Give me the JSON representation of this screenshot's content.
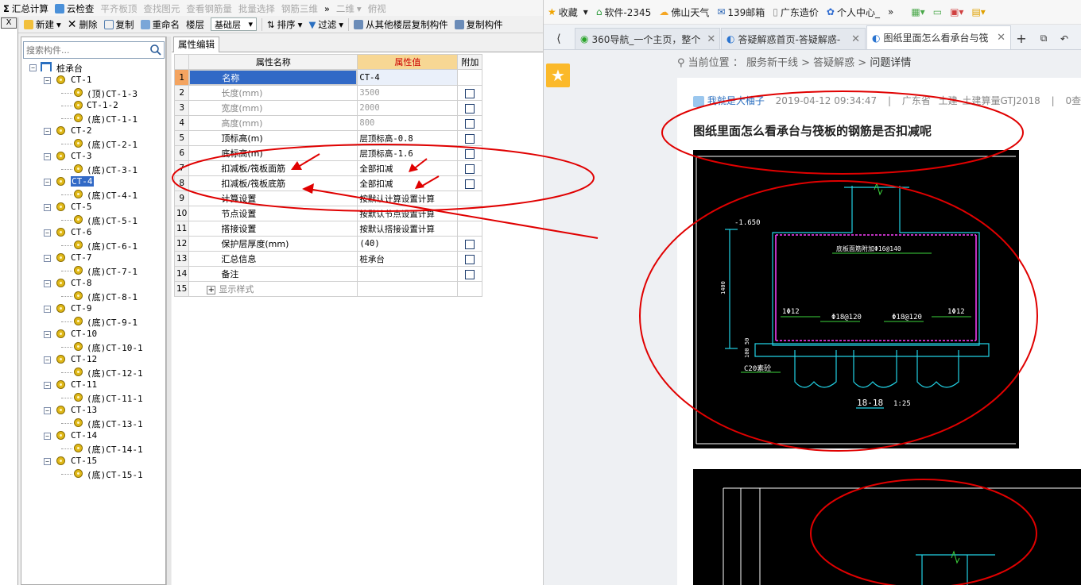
{
  "toolbar_top": {
    "items": [
      "汇总计算",
      "云检查",
      "平齐板顶",
      "查找图元",
      "查看钢筋量",
      "批量选择",
      "钢筋三维",
      "二维",
      "俯视"
    ]
  },
  "toolbar_main": {
    "new": "新建",
    "delete": "删除",
    "copy": "复制",
    "rename": "重命名",
    "floor_label": "楼层",
    "floor_value": "基础层",
    "sort": "排序",
    "filter": "过滤",
    "copy_from_floor": "从其他楼层复制构件",
    "copy_component": "复制构件"
  },
  "close_btn": "X",
  "search": {
    "placeholder": "搜索构件..."
  },
  "tree": {
    "root": "桩承台",
    "nodes": [
      {
        "label": "CT-1",
        "children": [
          "(顶)CT-1-3",
          "CT-1-2",
          "(底)CT-1-1"
        ]
      },
      {
        "label": "CT-2",
        "children": [
          "(底)CT-2-1"
        ]
      },
      {
        "label": "CT-3",
        "children": [
          "(底)CT-3-1"
        ]
      },
      {
        "label": "CT-4",
        "children": [
          "(底)CT-4-1"
        ],
        "selected": true
      },
      {
        "label": "CT-5",
        "children": [
          "(底)CT-5-1"
        ]
      },
      {
        "label": "CT-6",
        "children": [
          "(底)CT-6-1"
        ]
      },
      {
        "label": "CT-7",
        "children": [
          "(底)CT-7-1"
        ]
      },
      {
        "label": "CT-8",
        "children": [
          "(底)CT-8-1"
        ]
      },
      {
        "label": "CT-9",
        "children": [
          "(底)CT-9-1"
        ]
      },
      {
        "label": "CT-10",
        "children": [
          "(底)CT-10-1"
        ]
      },
      {
        "label": "CT-12",
        "children": [
          "(底)CT-12-1"
        ]
      },
      {
        "label": "CT-11",
        "children": [
          "(底)CT-11-1"
        ]
      },
      {
        "label": "CT-13",
        "children": [
          "(底)CT-13-1"
        ]
      },
      {
        "label": "CT-14",
        "children": [
          "(底)CT-14-1"
        ]
      },
      {
        "label": "CT-15",
        "children": [
          "(底)CT-15-1"
        ]
      }
    ]
  },
  "panel_tab": "属性编辑",
  "grid": {
    "headers": [
      "属性名称",
      "属性值",
      "附加"
    ],
    "rows": [
      {
        "n": "1",
        "name": "名称",
        "value": "CT-4",
        "check": false
      },
      {
        "n": "2",
        "name": "长度(mm)",
        "value": "3500",
        "check": true
      },
      {
        "n": "3",
        "name": "宽度(mm)",
        "value": "2000",
        "check": true
      },
      {
        "n": "4",
        "name": "高度(mm)",
        "value": "800",
        "check": true
      },
      {
        "n": "5",
        "name": "顶标高(m)",
        "value": "层顶标高-0.8",
        "check": true
      },
      {
        "n": "6",
        "name": "底标高(m)",
        "value": "层顶标高-1.6",
        "check": true
      },
      {
        "n": "7",
        "name": "扣减板/筏板面筋",
        "value": "全部扣减",
        "check": true
      },
      {
        "n": "8",
        "name": "扣减板/筏板底筋",
        "value": "全部扣减",
        "check": true
      },
      {
        "n": "9",
        "name": "计算设置",
        "value": "按默认计算设置计算",
        "check": false
      },
      {
        "n": "10",
        "name": "节点设置",
        "value": "按默认节点设置计算",
        "check": false
      },
      {
        "n": "11",
        "name": "搭接设置",
        "value": "按默认搭接设置计算",
        "check": false
      },
      {
        "n": "12",
        "name": "保护层厚度(mm)",
        "value": "(40)",
        "check": true
      },
      {
        "n": "13",
        "name": "汇总信息",
        "value": "桩承台",
        "check": true
      },
      {
        "n": "14",
        "name": "备注",
        "value": "",
        "check": true
      },
      {
        "n": "15",
        "name": "显示样式",
        "value": "",
        "check": false
      }
    ]
  },
  "bookmarks": [
    "收藏",
    "软件-2345",
    "佛山天气",
    "139邮箱",
    "广东造价",
    "个人中心_"
  ],
  "browser_tabs": [
    "360导航_一个主页，整个",
    "答疑解惑首页-答疑解惑-",
    "图纸里面怎么看承台与筏"
  ],
  "breadcrumb": {
    "label": "当前位置",
    "items": [
      "服务新干线",
      "答疑解惑",
      "问题详情"
    ]
  },
  "question": {
    "author": "我就是大柚子",
    "time": "2019-04-12 09:34:47",
    "region": "广东省",
    "category": "土建",
    "software": "土建算量GTJ2018",
    "views": "0查",
    "title": "图纸里面怎么看承台与筏板的钢筋是否扣减呢"
  },
  "drawing": {
    "elev": "-1.650",
    "rebar_top": "底板面筋附加Φ16@140",
    "left_bar": "1Φ12",
    "right_bar": "1Φ12",
    "mid1": "Φ18@120",
    "mid2": "Φ18@120",
    "pile_cap": "C20素砼",
    "dim_h": "1400",
    "dim_b": "100 50",
    "section": "18-18",
    "scale": "1:25"
  },
  "colors": {
    "annotation": "#e00000",
    "selected": "#3169c6",
    "header_val": "#f7d794",
    "cad_cyan": "#22d3e6"
  }
}
